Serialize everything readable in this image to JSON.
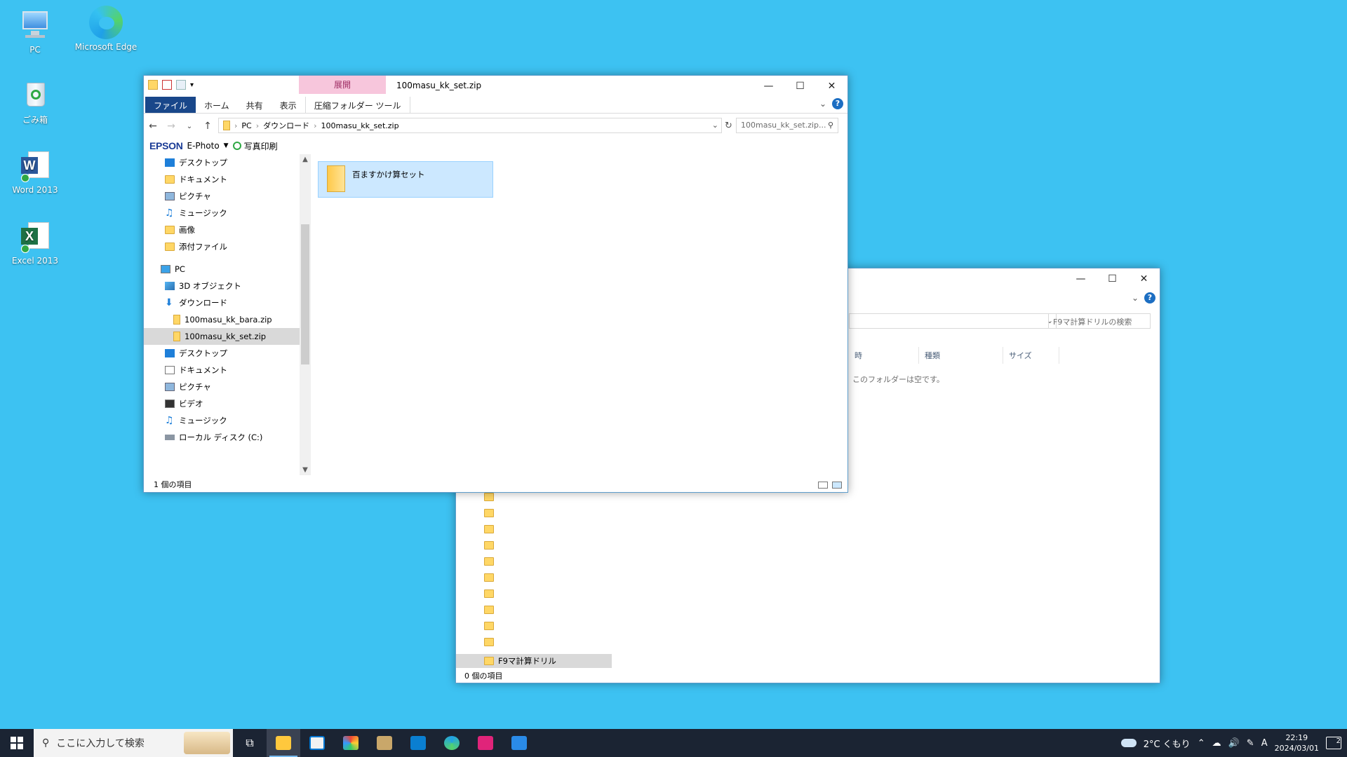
{
  "desktop": {
    "icons": [
      {
        "label": "PC"
      },
      {
        "label": "Microsoft Edge"
      },
      {
        "label": "ごみ箱"
      },
      {
        "label": "Word 2013"
      },
      {
        "label": "Excel 2013"
      }
    ]
  },
  "back_window": {
    "search_placeholder": "F9マ計算ドリルの検索",
    "columns": [
      "時",
      "種類",
      "サイズ"
    ],
    "empty_message": "このフォルダーは空です。",
    "nav_selected": "F9マ計算ドリル",
    "status": "0 個の項目"
  },
  "front_window": {
    "title": "100masu_kk_set.zip",
    "context_tab": "展開",
    "ribbon_tabs": {
      "file": "ファイル",
      "home": "ホーム",
      "share": "共有",
      "view": "表示",
      "tool": "圧縮フォルダー ツール"
    },
    "address": {
      "segments": [
        "PC",
        "ダウンロード",
        "100masu_kk_set.zip"
      ]
    },
    "search_placeholder": "100masu_kk_set.zip...",
    "epson": {
      "logo": "EPSON",
      "app": "E-Photo",
      "photo_print": "写真印刷"
    },
    "tree": [
      {
        "label": "デスクトップ",
        "icon": "desktop-icon"
      },
      {
        "label": "ドキュメント",
        "icon": "folder-icon"
      },
      {
        "label": "ピクチャ",
        "icon": "pictures-icon"
      },
      {
        "label": "ミュージック",
        "icon": "music-icon"
      },
      {
        "label": "画像",
        "icon": "folder-icon"
      },
      {
        "label": "添付ファイル",
        "icon": "folder-icon"
      },
      {
        "label": "PC",
        "icon": "pc-icon"
      },
      {
        "label": "3D オブジェクト",
        "icon": "3d-objects-icon"
      },
      {
        "label": "ダウンロード",
        "icon": "download-icon"
      },
      {
        "label": "100masu_kk_bara.zip",
        "icon": "zip-icon"
      },
      {
        "label": "100masu_kk_set.zip",
        "icon": "zip-icon"
      },
      {
        "label": "デスクトップ",
        "icon": "desktop-icon"
      },
      {
        "label": "ドキュメント",
        "icon": "document-icon"
      },
      {
        "label": "ピクチャ",
        "icon": "pictures-icon"
      },
      {
        "label": "ビデオ",
        "icon": "video-icon"
      },
      {
        "label": "ミュージック",
        "icon": "music-icon"
      },
      {
        "label": "ローカル ディスク (C:)",
        "icon": "disk-icon"
      }
    ],
    "files": [
      {
        "name": "百ますかけ算セット",
        "icon": "folder-icon"
      }
    ],
    "status": "1 個の項目"
  },
  "taskbar": {
    "search_placeholder": "ここに入力して検索",
    "weather": "2°C くもり",
    "time": "22:19",
    "date": "2024/03/01",
    "notification_count": "2",
    "apps": [
      "task-view-icon",
      "file-explorer-icon",
      "store-icon",
      "paint-icon",
      "photo-app-icon",
      "mail-icon",
      "edge-icon",
      "hpb-icon",
      "photos-icon"
    ]
  },
  "colors": {
    "desktop": "#3dc2f2",
    "taskbar": "#1b2433",
    "accent": "#19478a",
    "selection": "#cce8ff",
    "context_tab": "#f7c6dc"
  }
}
